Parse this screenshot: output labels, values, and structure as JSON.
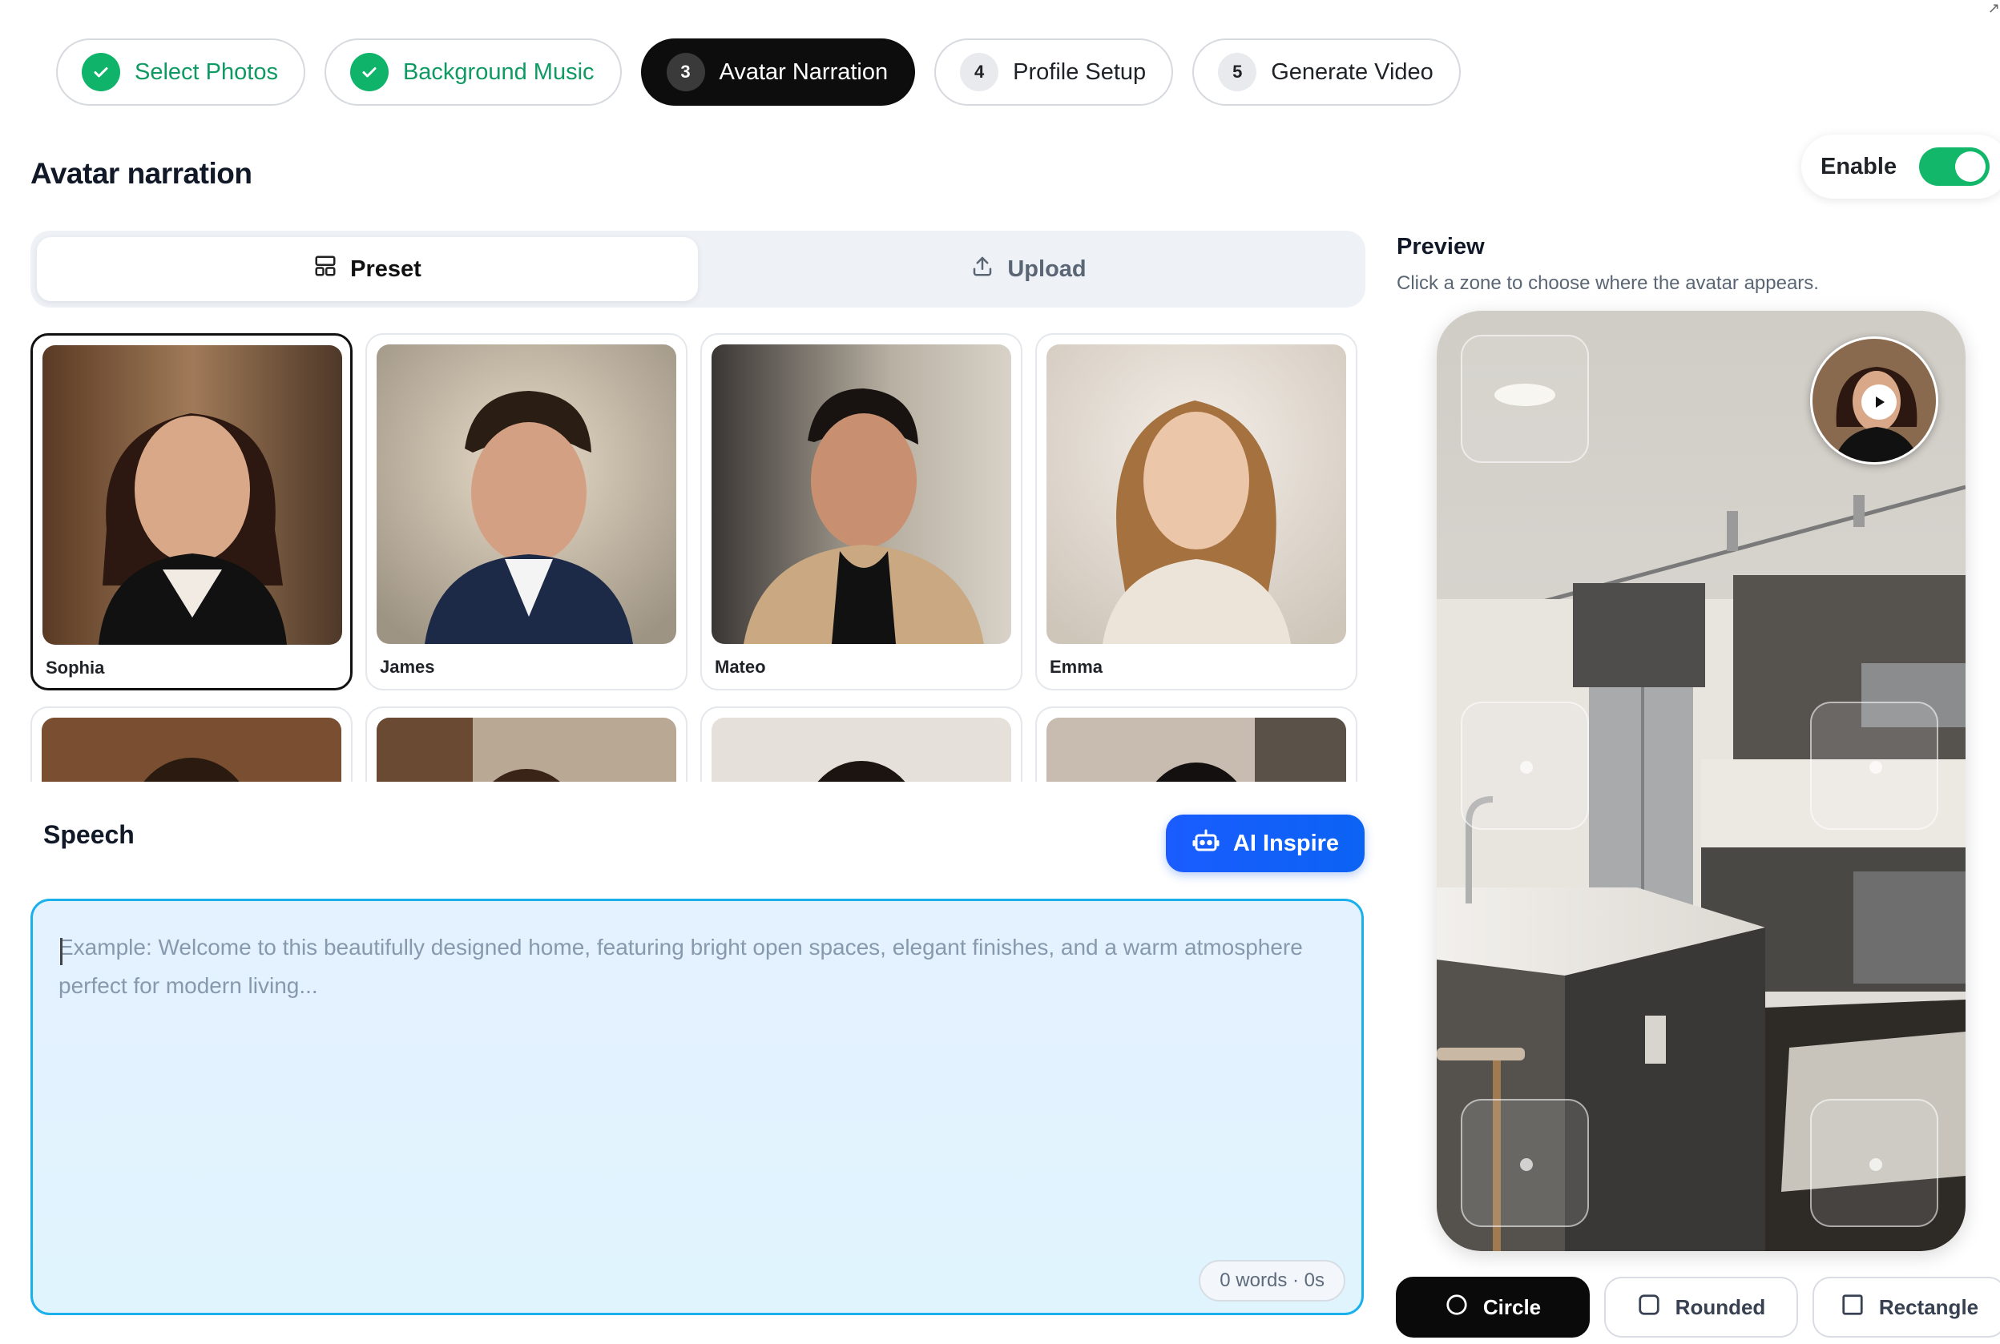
{
  "stepper": [
    {
      "num": "",
      "label": "Select Photos",
      "state": "done"
    },
    {
      "num": "",
      "label": "Background Music",
      "state": "done"
    },
    {
      "num": "3",
      "label": "Avatar Narration",
      "state": "active"
    },
    {
      "num": "4",
      "label": "Profile Setup",
      "state": "todo"
    },
    {
      "num": "5",
      "label": "Generate Video",
      "state": "todo"
    }
  ],
  "page_title": "Avatar narration",
  "enable": {
    "label": "Enable",
    "on": true
  },
  "source_tabs": {
    "preset": "Preset",
    "upload": "Upload",
    "selected": "Preset"
  },
  "avatars": [
    {
      "name": "Sophia",
      "selected": true
    },
    {
      "name": "James",
      "selected": false
    },
    {
      "name": "Mateo",
      "selected": false
    },
    {
      "name": "Emma",
      "selected": false
    }
  ],
  "speech": {
    "label": "Speech",
    "ai_button": "AI Inspire",
    "placeholder": "Example: Welcome to this beautifully designed home, featuring bright open spaces, elegant finishes, and a warm atmosphere perfect for modern living...",
    "counter": "0 words · 0s"
  },
  "preview": {
    "title": "Preview",
    "subtitle": "Click a zone to choose where the avatar appears."
  },
  "shapes": {
    "circle": "Circle",
    "rounded": "Rounded",
    "rectangle": "Rectangle",
    "selected": "Circle"
  },
  "colors": {
    "accent_green": "#12b76a",
    "accent_blue": "#1a5cff",
    "active_dark": "#0d0d0d"
  }
}
